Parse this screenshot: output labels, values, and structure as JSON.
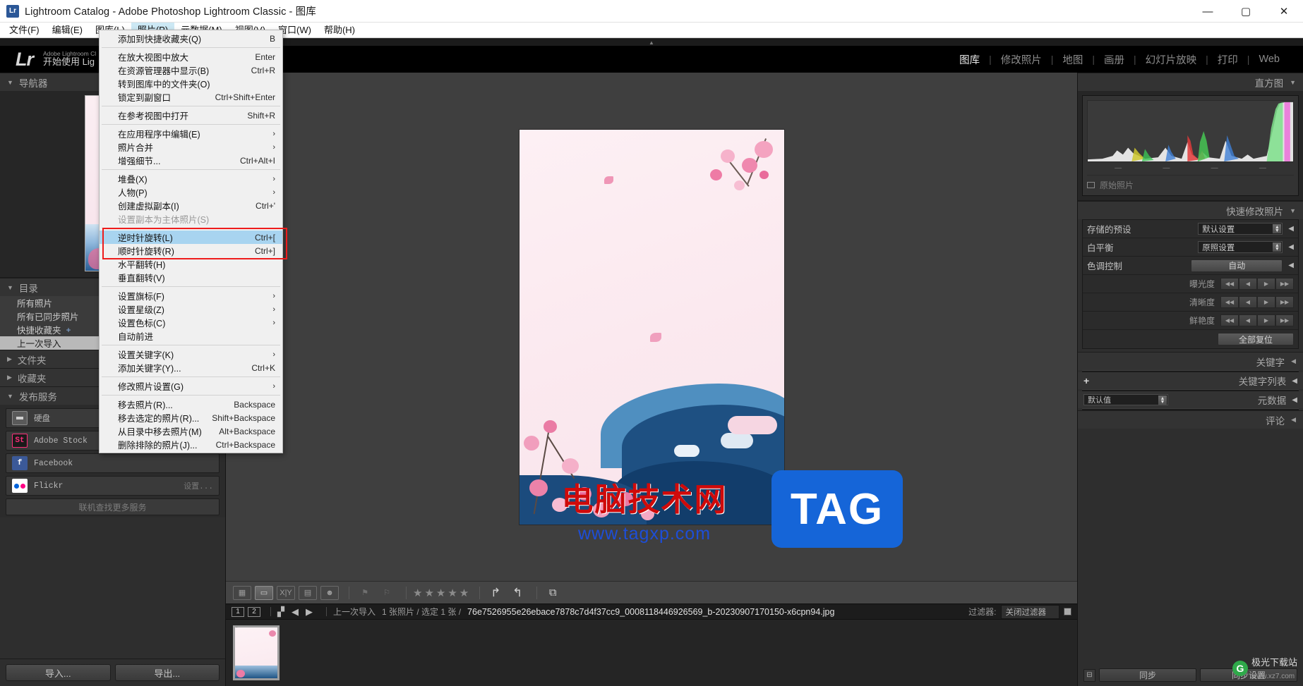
{
  "window": {
    "app_icon": "Lr",
    "title": "Lightroom Catalog - Adobe Photoshop Lightroom Classic - 图库",
    "minimize": "—",
    "maximize": "▢",
    "close": "✕"
  },
  "menubar": {
    "items": [
      {
        "label": "文件(F)",
        "open": false
      },
      {
        "label": "编辑(E)",
        "open": false
      },
      {
        "label": "图库(L)",
        "open": false
      },
      {
        "label": "照片(P)",
        "open": true
      },
      {
        "label": "元数据(M)",
        "open": false
      },
      {
        "label": "视图(V)",
        "open": false
      },
      {
        "label": "窗口(W)",
        "open": false
      },
      {
        "label": "帮助(H)",
        "open": false
      }
    ]
  },
  "photo_menu": {
    "groups": [
      [
        {
          "label": "添加到快捷收藏夹(Q)",
          "key": "B",
          "state": "normal"
        }
      ],
      [
        {
          "label": "在放大视图中放大",
          "key": "Enter",
          "state": "normal"
        },
        {
          "label": "在资源管理器中显示(B)",
          "key": "Ctrl+R",
          "state": "normal"
        },
        {
          "label": "转到图库中的文件夹(O)",
          "key": "",
          "state": "normal"
        },
        {
          "label": "锁定到副窗口",
          "key": "Ctrl+Shift+Enter",
          "state": "normal"
        }
      ],
      [
        {
          "label": "在参考视图中打开",
          "key": "Shift+R",
          "state": "normal"
        }
      ],
      [
        {
          "label": "在应用程序中编辑(E)",
          "key": "",
          "state": "submenu"
        },
        {
          "label": "照片合并",
          "key": "",
          "state": "submenu"
        },
        {
          "label": "增强细节...",
          "key": "Ctrl+Alt+I",
          "state": "normal"
        }
      ],
      [
        {
          "label": "堆叠(X)",
          "key": "",
          "state": "submenu"
        },
        {
          "label": "人物(P)",
          "key": "",
          "state": "submenu"
        },
        {
          "label": "创建虚拟副本(I)",
          "key": "Ctrl+'",
          "state": "normal"
        },
        {
          "label": "设置副本为主体照片(S)",
          "key": "",
          "state": "disabled"
        }
      ],
      [
        {
          "label": "逆时针旋转(L)",
          "key": "Ctrl+[",
          "state": "highlighted"
        },
        {
          "label": "顺时针旋转(R)",
          "key": "Ctrl+]",
          "state": "normal"
        },
        {
          "label": "水平翻转(H)",
          "key": "",
          "state": "normal"
        },
        {
          "label": "垂直翻转(V)",
          "key": "",
          "state": "normal"
        }
      ],
      [
        {
          "label": "设置旗标(F)",
          "key": "",
          "state": "submenu"
        },
        {
          "label": "设置星级(Z)",
          "key": "",
          "state": "submenu"
        },
        {
          "label": "设置色标(C)",
          "key": "",
          "state": "submenu"
        },
        {
          "label": "自动前进",
          "key": "",
          "state": "normal"
        }
      ],
      [
        {
          "label": "设置关键字(K)",
          "key": "",
          "state": "submenu"
        },
        {
          "label": "添加关键字(Y)...",
          "key": "Ctrl+K",
          "state": "normal"
        }
      ],
      [
        {
          "label": "修改照片设置(G)",
          "key": "",
          "state": "submenu"
        }
      ],
      [
        {
          "label": "移去照片(R)...",
          "key": "Backspace",
          "state": "normal"
        },
        {
          "label": "移去选定的照片(R)...",
          "key": "Shift+Backspace",
          "state": "normal"
        },
        {
          "label": "从目录中移去照片(M)",
          "key": "Alt+Backspace",
          "state": "normal"
        },
        {
          "label": "删除排除的照片(J)...",
          "key": "Ctrl+Backspace",
          "state": "normal"
        }
      ]
    ]
  },
  "identity": {
    "logo": "Lr",
    "line1": "Adobe Lightroom Cl",
    "line2": "开始使用 Lig",
    "modules": [
      {
        "label": "图库",
        "active": true
      },
      {
        "label": "修改照片",
        "active": false
      },
      {
        "label": "地图",
        "active": false
      },
      {
        "label": "画册",
        "active": false
      },
      {
        "label": "幻灯片放映",
        "active": false
      },
      {
        "label": "打印",
        "active": false
      },
      {
        "label": "Web",
        "active": false
      }
    ],
    "separator": "|"
  },
  "left_panel": {
    "navigator": {
      "title": "导航器",
      "triangle": "▼"
    },
    "catalog": {
      "title": "目录",
      "triangle": "▼",
      "rows": [
        {
          "label": "所有照片",
          "selected": false,
          "plus": ""
        },
        {
          "label": "所有已同步照片",
          "selected": false,
          "plus": ""
        },
        {
          "label": "快捷收藏夹",
          "selected": false,
          "plus": "+"
        },
        {
          "label": "上一次导入",
          "selected": true,
          "plus": ""
        }
      ]
    },
    "folders": {
      "title": "文件夹",
      "triangle": "▶"
    },
    "collections": {
      "title": "收藏夹",
      "triangle": "▶"
    },
    "publish": {
      "title": "发布服务",
      "triangle": "▼",
      "services": [
        {
          "label": "硬盘",
          "icon": "harddrive-icon",
          "setup": ""
        },
        {
          "label": "Adobe Stock",
          "icon": "adobe-stock-icon",
          "setup": ""
        },
        {
          "label": "Facebook",
          "icon": "facebook-icon",
          "setup": ""
        },
        {
          "label": "Flickr",
          "icon": "flickr-icon",
          "setup": "设置..."
        }
      ],
      "more": "联机查找更多服务"
    },
    "buttons": {
      "import": "导入...",
      "export": "导出..."
    }
  },
  "toolbar": {
    "view_icons": [
      {
        "name": "grid-view-icon",
        "glyph": "▦",
        "active": false
      },
      {
        "name": "loupe-view-icon",
        "glyph": "▭",
        "active": true
      },
      {
        "name": "compare-view-icon",
        "glyph": "X|Y",
        "active": false
      },
      {
        "name": "survey-view-icon",
        "glyph": "▤",
        "active": false
      },
      {
        "name": "people-view-icon",
        "glyph": "☻",
        "active": false
      }
    ],
    "flag_icons": [
      {
        "name": "flag-pick-icon",
        "glyph": "⚑"
      },
      {
        "name": "flag-reject-icon",
        "glyph": "⚐"
      }
    ],
    "rating": "★★★★★",
    "rotate_icons": [
      {
        "name": "rotate-right-icon",
        "glyph": "↱"
      },
      {
        "name": "rotate-left-icon",
        "glyph": "↰"
      }
    ],
    "face_icon": {
      "name": "face-region-icon",
      "glyph": "⧉"
    }
  },
  "filmstrip_bar": {
    "pages": [
      "1",
      "2"
    ],
    "grid_icon": "▞",
    "back_icon": "◀",
    "forward_icon": "▶",
    "source": "上一次导入",
    "count": "1 张照片 / 选定 1 张 /",
    "filename": "76e7526955e26ebace7878c7d4f37cc9_0008118446926569_b-20230907170150-x6cpn94.jpg",
    "filter_label": "过滤器:",
    "filter_value": "关闭过滤器"
  },
  "filmstrip": {
    "thumbs": [
      {
        "index": "1"
      }
    ]
  },
  "right_panel": {
    "histogram": {
      "title": "直方图",
      "triangle": "▼",
      "ticks": [
        "—",
        "—",
        "—",
        "—"
      ],
      "footer": "原始照片"
    },
    "quick_develop": {
      "title": "快速修改照片",
      "triangle": "▼",
      "preset_label": "存储的预设",
      "preset_value": "默认设置",
      "white_balance_label": "白平衡",
      "white_balance_value": "原照设置",
      "tone_label": "色调控制",
      "tone_auto": "自动",
      "sliders": [
        {
          "label": "曝光度"
        },
        {
          "label": "清晰度"
        },
        {
          "label": "鲜艳度"
        }
      ],
      "reset": "全部复位",
      "step_glyphs": [
        "◀◀",
        "◀",
        "▶",
        "▶▶"
      ],
      "collapse_arrow": "◀"
    },
    "keywords": {
      "title": "关键字",
      "triangle": "◀"
    },
    "keyword_list": {
      "title": "关键字列表",
      "triangle": "◀",
      "add": "+"
    },
    "metadata": {
      "title": "元数据",
      "triangle": "◀",
      "preset": "默认值"
    },
    "comments": {
      "title": "评论",
      "triangle": "◀"
    },
    "sync": {
      "sync_label": "同步",
      "sync_settings_label": "同步设置",
      "icon_glyph": "⊟"
    }
  },
  "watermark": {
    "chinese": "电脑技术网",
    "url": "www.tagxp.com",
    "tag": "TAG",
    "brand_icon": "G",
    "brand_name": "极光下载站",
    "brand_url": "www.xz7.com"
  },
  "colors": {
    "highlight_blue": "#a8d4f0",
    "red_box": "#ee1c1c",
    "panel_bg": "#2e2e2e",
    "accent_text": "#c0c0c0"
  }
}
